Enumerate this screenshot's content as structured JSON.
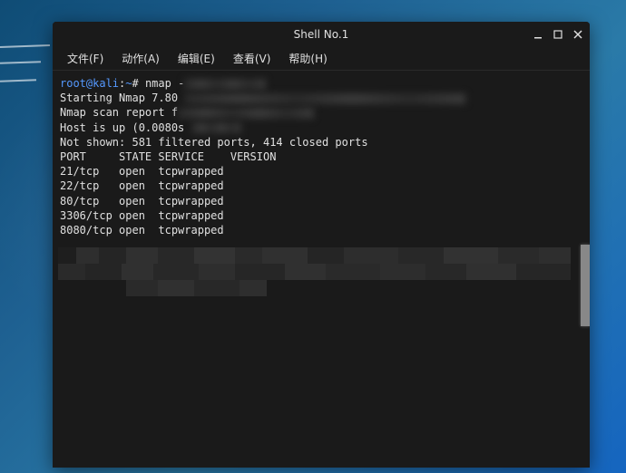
{
  "window": {
    "title": "Shell No.1"
  },
  "menu": {
    "file": "文件(F)",
    "action": "动作(A)",
    "edit": "编辑(E)",
    "view": "查看(V)",
    "help": "帮助(H)"
  },
  "terminal": {
    "prompt_user": "root@kali",
    "prompt_sep": ":",
    "prompt_path": "~",
    "prompt_hash": "# ",
    "command": "nmap -",
    "lines": {
      "l1": "Starting Nmap 7.80",
      "l2": "Nmap scan report f",
      "l3": "Host is up (0.0080s",
      "l4": "Not shown: 581 filtered ports, 414 closed ports",
      "header": "PORT     STATE SERVICE    VERSION",
      "p1": "21/tcp   open  tcpwrapped",
      "p2": "22/tcp   open  tcpwrapped",
      "p3": "80/tcp   open  tcpwrapped",
      "p4": "3306/tcp open  tcpwrapped",
      "p5": "8080/tcp open  tcpwrapped"
    }
  }
}
